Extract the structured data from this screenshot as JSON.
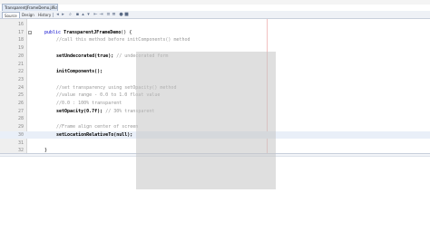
{
  "window": {
    "file_tab": "TransparentJFrameDemo.java"
  },
  "toolbar": {
    "tabs": [
      {
        "label": "Source",
        "active": true
      },
      {
        "label": "Design",
        "active": false
      },
      {
        "label": "History",
        "active": false
      }
    ],
    "icons": [
      "back-icon",
      "forward-icon",
      "find-icon",
      "toggle-bookmark-icon",
      "prev-bookmark-icon",
      "next-bookmark-icon",
      "shift-left-icon",
      "shift-right-icon",
      "comment-icon",
      "uncomment-icon",
      "run-macro-icon",
      "stop-macro-icon"
    ]
  },
  "editor": {
    "lines": [
      {
        "num": "16",
        "text": ""
      },
      {
        "num": "17",
        "text": "public TransparentJFrameDemo() {"
      },
      {
        "num": "18",
        "text": "//call this method before initComponents() method"
      },
      {
        "num": "19",
        "text": ""
      },
      {
        "num": "20",
        "text": "setUndecorated(true);",
        "comment": "// undecorated form"
      },
      {
        "num": "21",
        "text": ""
      },
      {
        "num": "22",
        "text": "initComponents();"
      },
      {
        "num": "23",
        "text": ""
      },
      {
        "num": "24",
        "text": "//set transparency using setOpacity() method"
      },
      {
        "num": "25",
        "text": "//value range - 0.0 to 1.0 float value"
      },
      {
        "num": "26",
        "text": "//0.0 : 100% transparent"
      },
      {
        "num": "27",
        "text": "setOpacity(0.7f);",
        "comment": "// 30% transparent"
      },
      {
        "num": "28",
        "text": ""
      },
      {
        "num": "29",
        "text": "//Frame align center of screen"
      },
      {
        "num": "30",
        "text": "setLocationRelativeTo(null);"
      },
      {
        "num": "31",
        "text": ""
      },
      {
        "num": "32",
        "text": "}"
      }
    ]
  }
}
